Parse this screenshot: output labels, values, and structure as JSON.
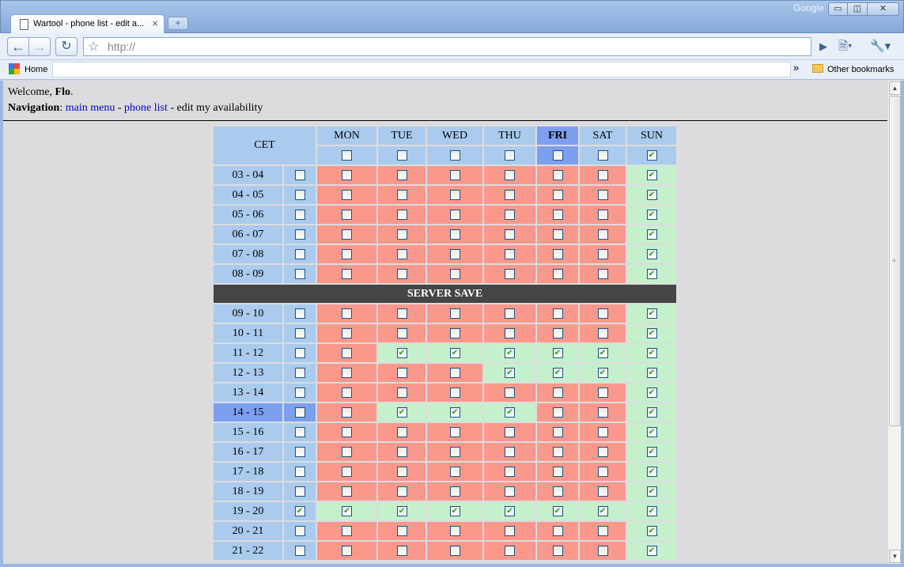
{
  "browser": {
    "tab_title": "Wartool - phone list - edit a...",
    "tab_close": "×",
    "new_tab": "+",
    "brand": "Google",
    "window_buttons": {
      "minimize": "▭",
      "maximize": "◫",
      "close": "✕"
    },
    "url_placeholder": "http://",
    "bookmarks": {
      "home": "Home",
      "chevron": "»",
      "other": "Other bookmarks"
    }
  },
  "page": {
    "welcome_prefix": "Welcome, ",
    "welcome_user": "Flo",
    "welcome_suffix": ".",
    "nav_label": "Navigation",
    "nav_colon": ": ",
    "nav_links": [
      "main menu",
      "phone list"
    ],
    "nav_sep": " - ",
    "nav_current": "edit my availability"
  },
  "availability": {
    "timezone_label": "CET",
    "days": [
      "MON",
      "TUE",
      "WED",
      "THU",
      "FRI",
      "SAT",
      "SUN"
    ],
    "selected_day": "FRI",
    "day_header_checked": [
      false,
      false,
      false,
      false,
      false,
      false,
      true
    ],
    "server_save_label": "SERVER SAVE",
    "rows_before_save": [
      {
        "time": "03 - 04",
        "row_checked": false,
        "days": [
          false,
          false,
          false,
          false,
          false,
          false,
          true
        ]
      },
      {
        "time": "04 - 05",
        "row_checked": false,
        "days": [
          false,
          false,
          false,
          false,
          false,
          false,
          true
        ]
      },
      {
        "time": "05 - 06",
        "row_checked": false,
        "days": [
          false,
          false,
          false,
          false,
          false,
          false,
          true
        ]
      },
      {
        "time": "06 - 07",
        "row_checked": false,
        "days": [
          false,
          false,
          false,
          false,
          false,
          false,
          true
        ]
      },
      {
        "time": "07 - 08",
        "row_checked": false,
        "days": [
          false,
          false,
          false,
          false,
          false,
          false,
          true
        ]
      },
      {
        "time": "08 - 09",
        "row_checked": false,
        "days": [
          false,
          false,
          false,
          false,
          false,
          false,
          true
        ]
      }
    ],
    "rows_after_save": [
      {
        "time": "09 - 10",
        "row_checked": false,
        "days": [
          false,
          false,
          false,
          false,
          false,
          false,
          true
        ]
      },
      {
        "time": "10 - 11",
        "row_checked": false,
        "days": [
          false,
          false,
          false,
          false,
          false,
          false,
          true
        ]
      },
      {
        "time": "11 - 12",
        "row_checked": false,
        "days": [
          false,
          true,
          true,
          true,
          true,
          true,
          true
        ]
      },
      {
        "time": "12 - 13",
        "row_checked": false,
        "days": [
          false,
          false,
          false,
          true,
          true,
          true,
          true
        ]
      },
      {
        "time": "13 - 14",
        "row_checked": false,
        "days": [
          false,
          false,
          false,
          false,
          false,
          false,
          true
        ]
      },
      {
        "time": "14 - 15",
        "row_checked": false,
        "selected": true,
        "days": [
          false,
          true,
          true,
          true,
          false,
          false,
          true
        ]
      },
      {
        "time": "15 - 16",
        "row_checked": false,
        "days": [
          false,
          false,
          false,
          false,
          false,
          false,
          true
        ]
      },
      {
        "time": "16 - 17",
        "row_checked": false,
        "days": [
          false,
          false,
          false,
          false,
          false,
          false,
          true
        ]
      },
      {
        "time": "17 - 18",
        "row_checked": false,
        "days": [
          false,
          false,
          false,
          false,
          false,
          false,
          true
        ]
      },
      {
        "time": "18 - 19",
        "row_checked": false,
        "days": [
          false,
          false,
          false,
          false,
          false,
          false,
          true
        ]
      },
      {
        "time": "19 - 20",
        "row_checked": true,
        "days": [
          true,
          true,
          true,
          true,
          true,
          true,
          true
        ]
      },
      {
        "time": "20 - 21",
        "row_checked": false,
        "days": [
          false,
          false,
          false,
          false,
          false,
          false,
          true
        ]
      },
      {
        "time": "21 - 22",
        "row_checked": false,
        "days": [
          false,
          false,
          false,
          false,
          false,
          false,
          true
        ]
      }
    ],
    "colors": {
      "available": "#c4f0cc",
      "unavailable": "#fa988c",
      "header": "#aacbee",
      "selected": "#7c9ff0",
      "server_save": "#454545"
    }
  }
}
